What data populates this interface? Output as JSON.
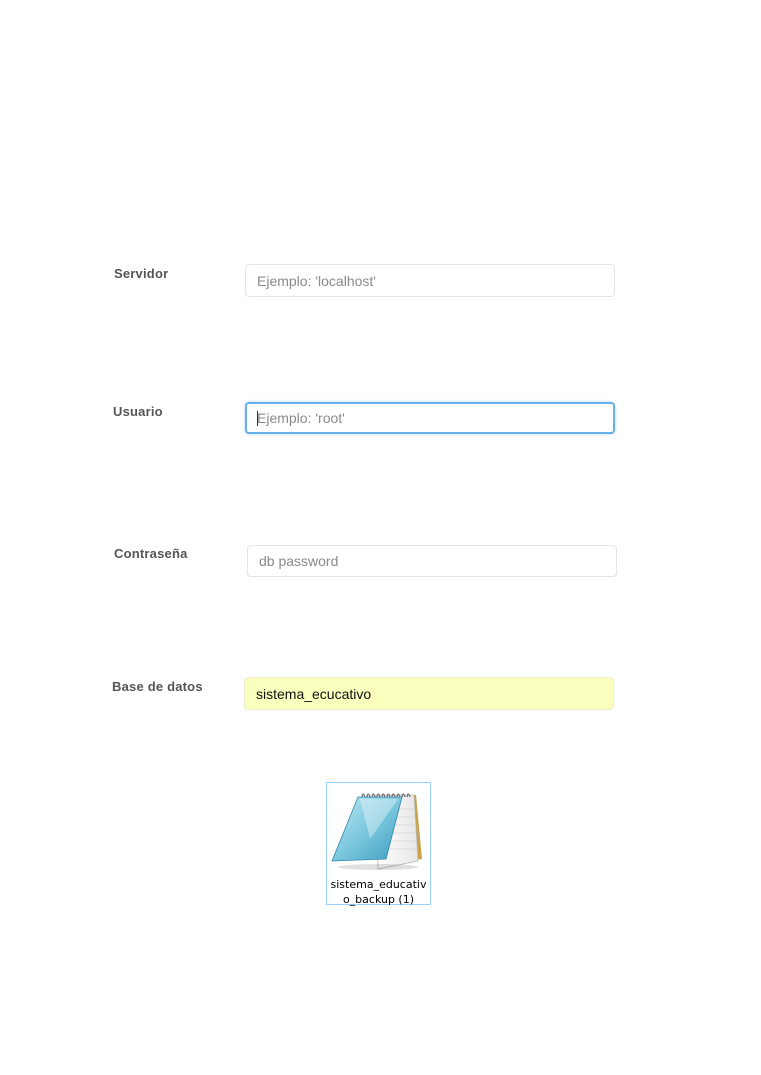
{
  "form": {
    "server": {
      "label": "Servidor",
      "value": "",
      "placeholder": "Ejemplo: 'localhost'"
    },
    "user": {
      "label": "Usuario",
      "value": "",
      "placeholder": "Ejemplo: 'root'"
    },
    "password": {
      "label": "Contraseña",
      "value": "",
      "placeholder": "db password"
    },
    "database": {
      "label": "Base de datos",
      "value": "sistema_ecucativo",
      "placeholder": ""
    }
  },
  "desktop_file": {
    "icon": "notepad-icon",
    "name_line1": "sistema_educativ",
    "name_line2": "o_backup (1)"
  },
  "colors": {
    "focus_border": "#66afe9",
    "autofill_bg": "#faffbd",
    "selection_border": "#99d1ff"
  }
}
